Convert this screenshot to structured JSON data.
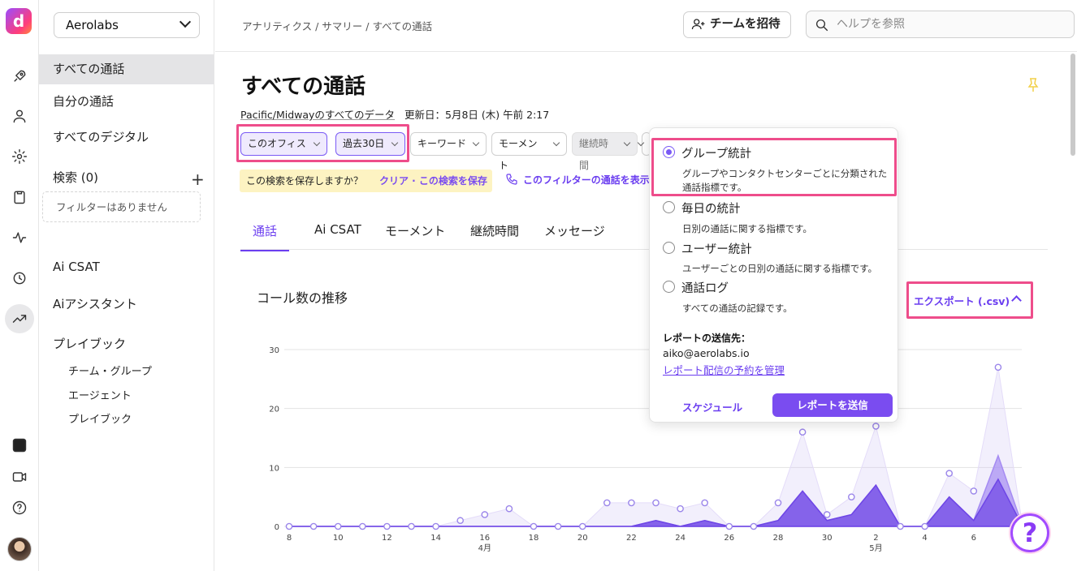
{
  "sidebar": {
    "workspace": "Aerolabs",
    "items": {
      "all_calls": "すべての通話",
      "my_calls": "自分の通話",
      "all_digital": "すべてのデジタル",
      "search": "検索 (0)",
      "no_filters": "フィルターはありません",
      "ai_csat": "Ai CSAT",
      "ai_assistant": "Aiアシスタント",
      "playbook": "プレイブック",
      "team_group": "チーム・グループ",
      "agent": "エージェント",
      "playbook_sub": "プレイブック"
    }
  },
  "header": {
    "breadcrumb": "アナリティクス / サマリー / すべての通話",
    "invite": "チームを招待",
    "help_placeholder": "ヘルプを参照"
  },
  "page": {
    "title": "すべての通話",
    "timezone_link": "Pacific/Midwayのすべてのデータ",
    "updated": "更新日：5月8日 (木) 午前 2:17",
    "filters": {
      "office": "このオフィス",
      "period": "過去30日",
      "keyword": "キーワード",
      "moment": "モーメント",
      "duration": "継続時間"
    },
    "save_prompt": "この検索を保存しますか？",
    "save_actions": "クリア · この検索を保存",
    "show_calls": "このフィルターの通話を表示",
    "tabs": [
      "通話",
      "Ai CSAT",
      "モーメント",
      "継続時間",
      "メッセージ"
    ],
    "chart_title": "コール数の推移",
    "export": "エクスポート (.csv)"
  },
  "export_menu": {
    "options": [
      {
        "label": "グループ統計",
        "desc": "グループやコンタクトセンターごとに分類された通話指標です。",
        "selected": true
      },
      {
        "label": "毎日の統計",
        "desc": "日別の通話に関する指標です。",
        "selected": false
      },
      {
        "label": "ユーザー統計",
        "desc": "ユーザーごとの日別の通話に関する指標です。",
        "selected": false
      },
      {
        "label": "通話ログ",
        "desc": "すべての通話の記録です。",
        "selected": false
      }
    ],
    "send_to_label": "レポートの送信先：",
    "email": "aiko@aerolabs.io",
    "manage_link": "レポート配信の予約を管理",
    "schedule": "スケジュール",
    "send_button": "レポートを送信"
  },
  "chart_data": {
    "type": "area",
    "title": "コール数の推移",
    "ylim": [
      0,
      30
    ],
    "yticks": [
      "0",
      "10",
      "20",
      "30"
    ],
    "x_tick_labels": [
      "8",
      "10",
      "12",
      "14",
      "16",
      "18",
      "20",
      "22",
      "24",
      "26",
      "28",
      "30",
      "2",
      "4",
      "6"
    ],
    "x_month_labels": [
      {
        "at": "16",
        "label": "4月"
      },
      {
        "at": "2",
        "label": "5月"
      }
    ],
    "x": [
      "4/8",
      "4/9",
      "4/10",
      "4/11",
      "4/12",
      "4/13",
      "4/14",
      "4/15",
      "4/16",
      "4/17",
      "4/18",
      "4/19",
      "4/20",
      "4/21",
      "4/22",
      "4/23",
      "4/24",
      "4/25",
      "4/26",
      "4/27",
      "4/28",
      "4/29",
      "4/30",
      "5/1",
      "5/2",
      "5/3",
      "5/4",
      "5/5",
      "5/6",
      "5/7",
      "5/8"
    ],
    "series": [
      {
        "values": [
          0,
          0,
          0,
          0,
          0,
          0,
          0,
          1,
          2,
          3,
          0,
          0,
          0,
          4,
          4,
          4,
          3,
          4,
          0,
          0,
          4,
          16,
          2,
          5,
          17,
          0,
          0,
          9,
          6,
          27,
          0
        ],
        "color": "#cbbef5"
      },
      {
        "values": [
          0,
          0,
          0,
          0,
          0,
          0,
          0,
          0,
          0,
          0,
          0,
          0,
          0,
          0,
          0,
          1,
          0,
          1,
          0,
          0,
          1,
          6,
          1,
          2,
          7,
          0,
          0,
          5,
          1,
          12,
          0
        ],
        "color": "#a58bf2"
      },
      {
        "values": [
          0,
          0,
          0,
          0,
          0,
          0,
          0,
          0,
          0,
          0,
          0,
          0,
          0,
          0,
          0,
          1,
          0,
          1,
          0,
          0,
          1,
          6,
          1,
          2,
          7,
          0,
          0,
          5,
          1,
          8,
          0
        ],
        "color": "#6e46e6"
      }
    ],
    "grid": true
  }
}
